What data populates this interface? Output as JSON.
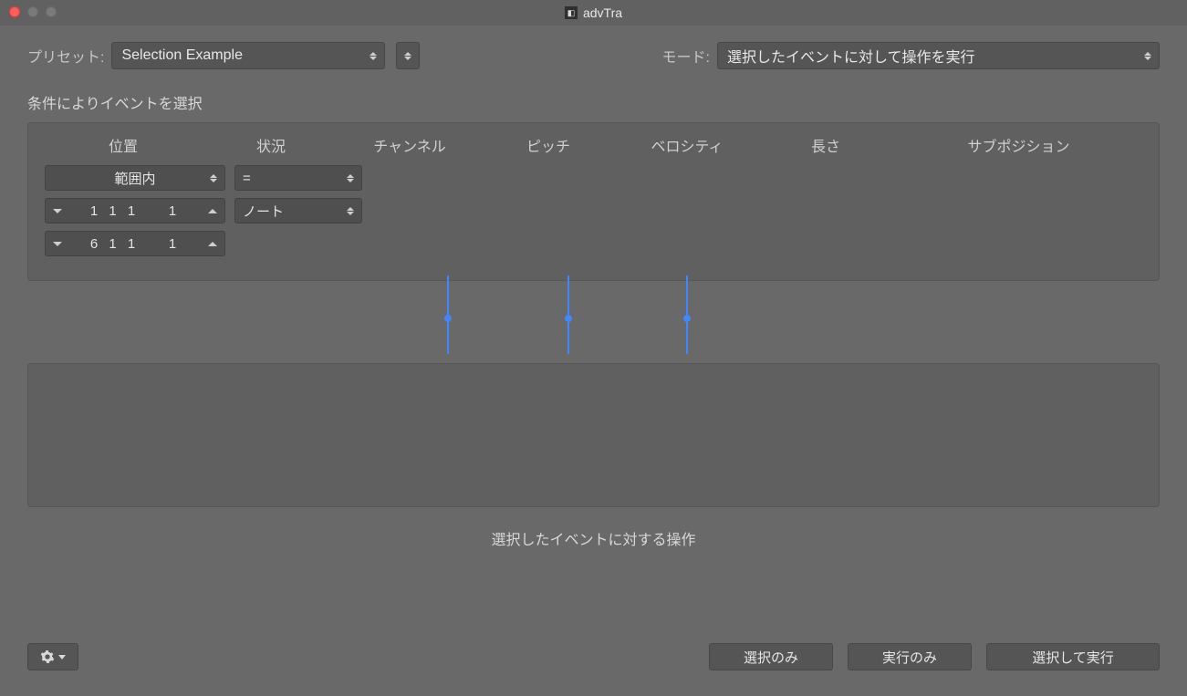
{
  "title": "advTra",
  "toolbar": {
    "preset_label": "プリセット:",
    "preset_value": "Selection Example",
    "mode_label": "モード:",
    "mode_value": "選択したイベントに対して操作を実行"
  },
  "section_select_title": "条件によりイベントを選択",
  "columns": {
    "position": "位置",
    "status": "状況",
    "channel": "チャンネル",
    "pitch": "ピッチ",
    "velocity": "ベロシティ",
    "length": "長さ",
    "subposition": "サブポジション"
  },
  "criteria": {
    "position_mode": "範囲内",
    "status_op": "=",
    "status_type": "ノート",
    "range_from": "1 1 1    1",
    "range_to": "6 1 1    1"
  },
  "ops_title": "選択したイベントに対する操作",
  "footer": {
    "select_only": "選択のみ",
    "execute_only": "実行のみ",
    "select_execute": "選択して実行"
  }
}
